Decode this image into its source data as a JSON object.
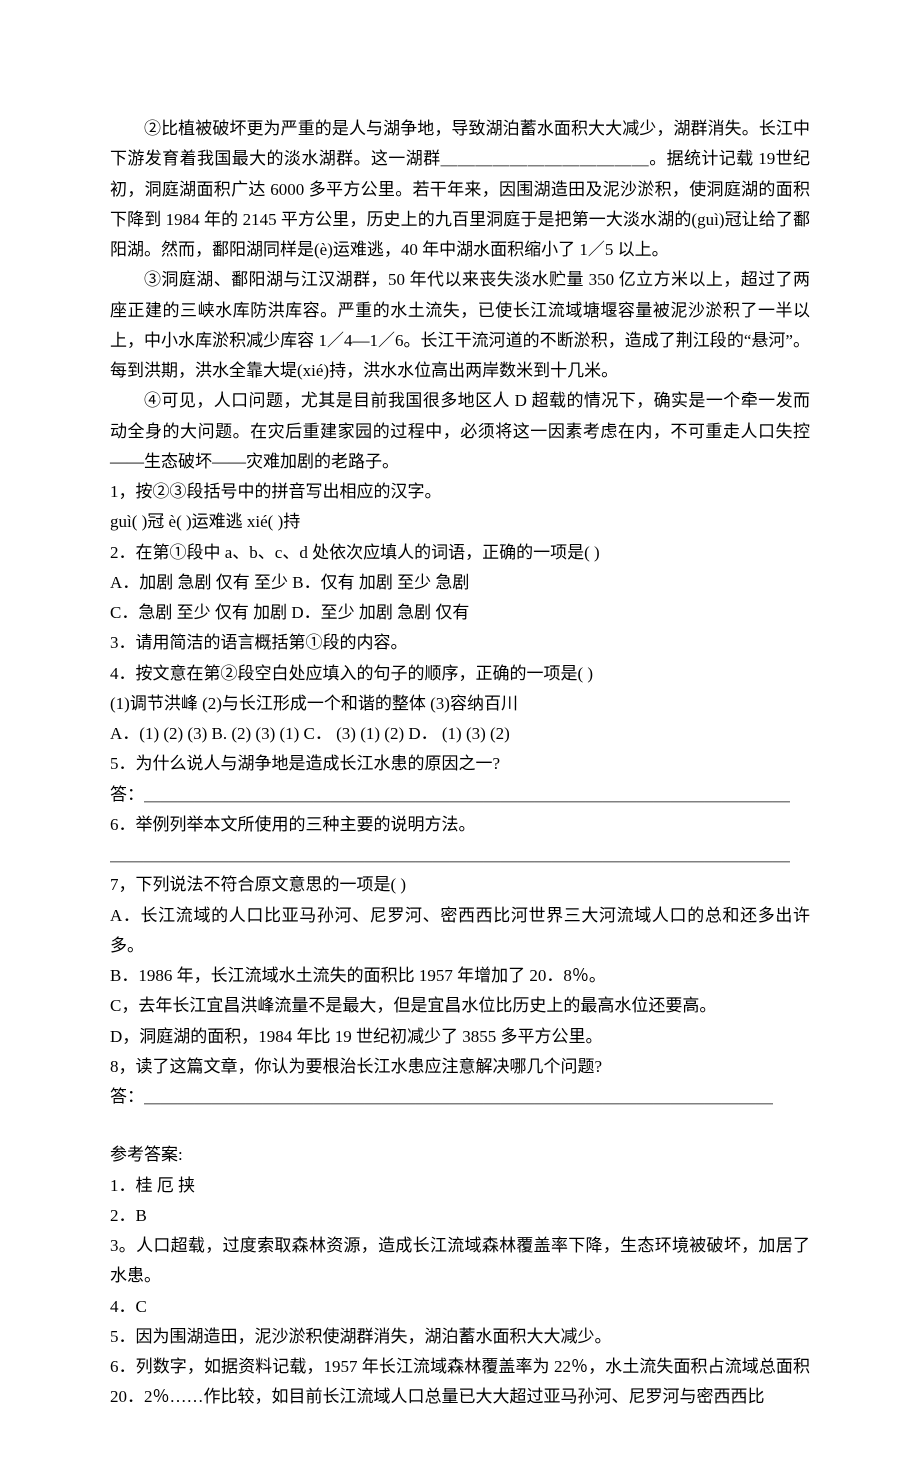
{
  "para2": "②比植被破坏更为严重的是人与湖争地，导致湖泊蓄水面积大大减少，湖群消失。长江中下游发育着我国最大的淡水湖群。这一湖群＿＿＿＿＿＿＿＿＿＿＿＿。据统计记载 19世纪初，洞庭湖面积广达 6000 多平方公里。若干年来，因围湖造田及泥沙淤积，使洞庭湖的面积下降到 1984 年的 2145 平方公里，历史上的九百里洞庭于是把第一大淡水湖的(guì)冠让给了鄱阳湖。然而，鄱阳湖同样是(è)运难逃，40 年中湖水面积缩小了 1／5 以上。",
  "para3": "③洞庭湖、鄱阳湖与江汉湖群，50 年代以来丧失淡水贮量 350 亿立方米以上，超过了两座正建的三峡水库防洪库容。严重的水土流失，已使长江流域塘堰容量被泥沙淤积了一半以上，中小水库淤积减少库容 1／4—1／6。长江干流河道的不断淤积，造成了荆江段的“悬河”。每到洪期，洪水全靠大堤(xié)持，洪水水位高出两岸数米到十几米。",
  "para4": "④可见，人口问题，尤其是目前我国很多地区人 D 超载的情况下，确实是一个牵一发而动全身的大问题。在灾后重建家园的过程中，必须将这一因素考虑在内，不可重走人口失控——生态破坏——灾难加剧的老路子。",
  "q1a": "1，按②③段括号中的拼音写出相应的汉字。",
  "q1b": "guì( )冠  è( )运难逃  xié( )持",
  "q2": "2．在第①段中 a、b、c、d 处依次应填人的词语，正确的一项是(  )",
  "q2A": "A．加剧  急剧  仅有  至少  B．仅有  加剧  至少  急剧",
  "q2C": "C．急剧  至少  仅有  加剧  D．至少  加剧  急剧  仅有",
  "q3": "3．请用简洁的语言概括第①段的内容。",
  "q4": "4．按文意在第②段空白处应填入的句子的顺序，正确的一项是(  )",
  "q4opts": "(1)调节洪峰  (2)与长江形成一个和谐的整体  (3)容纳百川",
  "q4abcd": "A．(1) (2) (3) B. (2) (3) (1) C．  (3) (1) (2) D．   (1) (3) (2)",
  "q5": "5．为什么说人与湖争地是造成长江水患的原因之一?",
  "q5ans": "答：＿＿＿＿＿＿＿＿＿＿＿＿＿＿＿＿＿＿＿＿＿＿＿＿＿＿＿＿＿＿＿＿＿＿＿＿＿＿",
  "q6": "6．举例列举本文所使用的三种主要的说明方法。",
  "q6ans": "＿＿＿＿＿＿＿＿＿＿＿＿＿＿＿＿＿＿＿＿＿＿＿＿＿＿＿＿＿＿＿＿＿＿＿＿＿＿＿＿",
  "q7": "7，下列说法不符合原文意思的一项是(  )",
  "q7A": "A．长江流域的人口比亚马孙河、尼罗河、密西西比河世界三大河流域人口的总和还多出许多。",
  "q7B": "B．1986 年，长江流域水土流失的面积比 1957 年增加了 20．8％。",
  "q7C": "C，去年长江宜昌洪峰流量不是最大，但是宜昌水位比历史上的最高水位还要高。",
  "q7D": "D，洞庭湖的面积，1984 年比 19 世纪初减少了 3855 多平方公里。",
  "q8": "8，读了这篇文章，你认为要根治长江水患应注意解决哪几个问题?",
  "q8ans": "答：＿＿＿＿＿＿＿＿＿＿＿＿＿＿＿＿＿＿＿＿＿＿＿＿＿＿＿＿＿＿＿＿＿＿＿＿＿",
  "answersTitle": "参考答案:",
  "a1": "1．桂  厄  挟",
  "a2": "2．B",
  "a3": "3。人口超载，过度索取森林资源，造成长江流域森林覆盖率下降，生态环境被破坏，加居了水患。",
  "a4": "4．C",
  "a5": "5．因为围湖造田，泥沙淤积使湖群消失，湖泊蓄水面积大大减少。",
  "a6": "6．列数字，如据资料记载，1957 年长江流域森林覆盖率为 22％，水土流失面积占流域总面积 20．2％……作比较，如目前长江流域人口总量已大大超过亚马孙河、尼罗河与密西西比"
}
